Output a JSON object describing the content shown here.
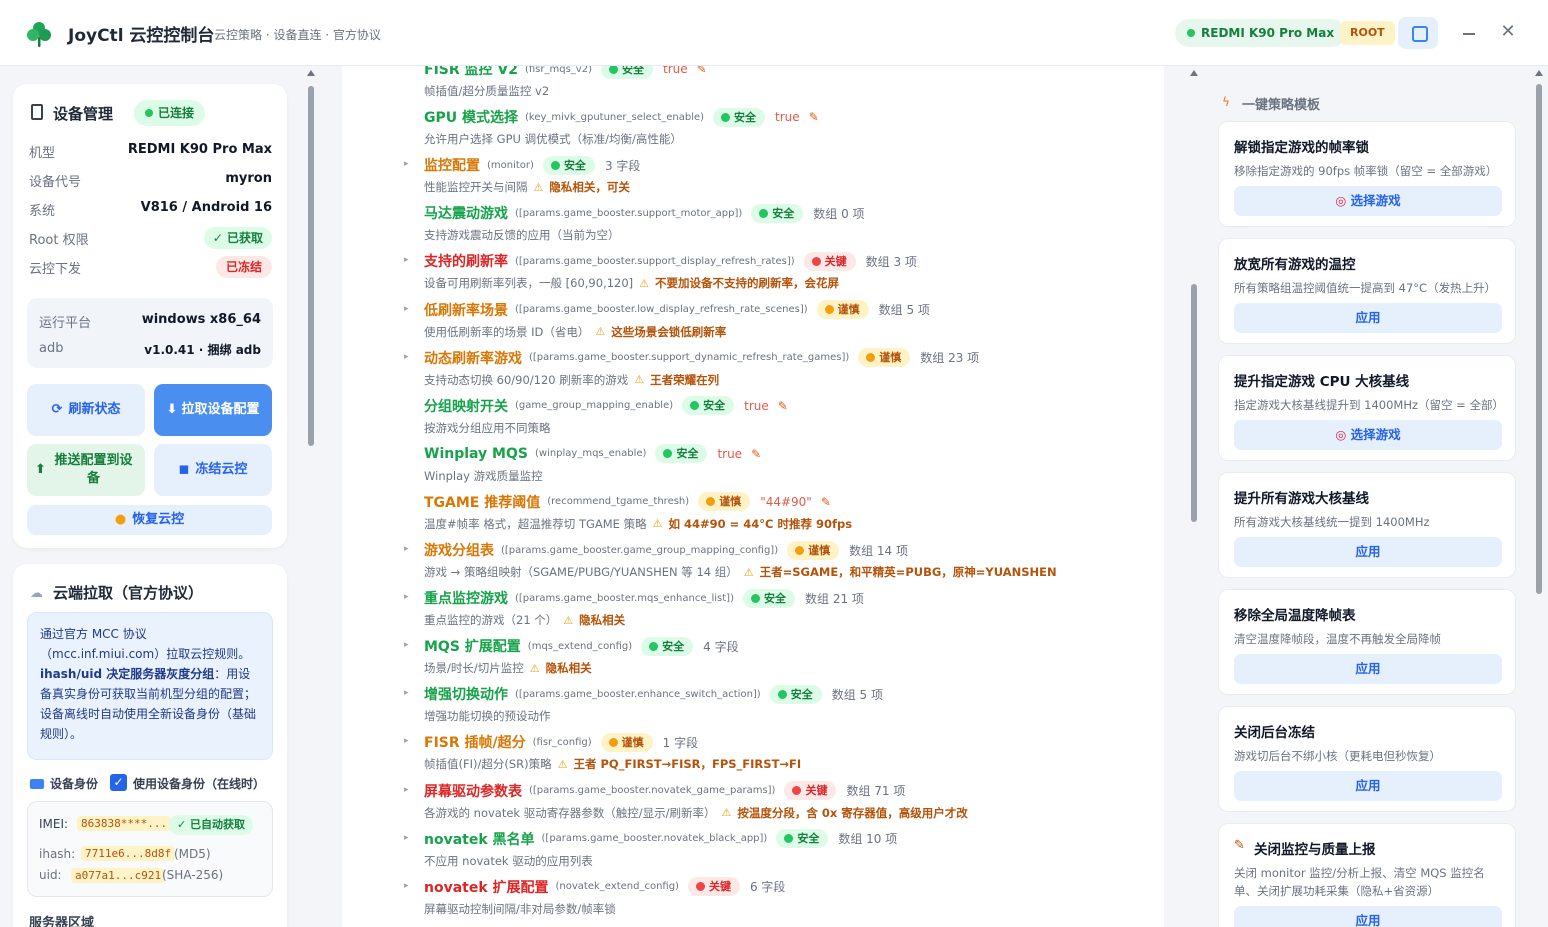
{
  "app": {
    "title": "JoyCtl 云控控制台",
    "subtitle": "云控策略 · 设备直连 · 官方协议",
    "device_pill": "REDMI K90 Pro Max",
    "root_pill": "ROOT"
  },
  "device": {
    "title": "设备管理",
    "status": "已连接",
    "rows": [
      {
        "k": "机型",
        "v": "REDMI K90 Pro Max"
      },
      {
        "k": "设备代号",
        "v": "myron"
      },
      {
        "k": "系统",
        "v": "V816 / Android 16"
      },
      {
        "k": "Root 权限",
        "v": "✓ 已获取"
      },
      {
        "k": "云控下发",
        "v": "已冻结"
      }
    ],
    "platform_k": "运行平台",
    "platform_v": "windows x86_64",
    "adb_k": "adb",
    "adb_v": "v1.0.41 · 捆绑 adb",
    "btn_refresh": "刷新状态",
    "btn_pull": "拉取设备配置",
    "btn_push": "推送配置到设备",
    "btn_freeze": "冻结云控",
    "btn_restore": "恢复云控"
  },
  "cloud": {
    "title": "云端拉取（官方协议）",
    "info_1": "通过官方 MCC 协议（mcc.inf.miui.com）拉取云控规则。",
    "info_bold": "ihash/uid 决定服务器灰度分组",
    "info_2": "：用设备真实身份可获取当前机型分组的配置；设备离线时自动使用全新设备身份（基础规则）。",
    "identity_label": "设备身份",
    "identity_check": "使用设备身份（在线时）",
    "imei_k": "IMEI:",
    "imei_v": "863838****...",
    "imei_tag": "✓ 已自动获取",
    "ihash_k": "ihash:",
    "ihash_v": "7711e6...8d8f",
    "ihash_t": "(MD5)",
    "uid_k": "uid:",
    "uid_v": "a077a1...c921",
    "uid_t": "(SHA-256)",
    "server_label": "服务器区域"
  },
  "rows": [
    {
      "name": "FISR 监控 V2",
      "key": "(fisr_mqs_v2)",
      "badge": "安全",
      "btype": "safe",
      "val": "true",
      "valtype": "red",
      "pen": true,
      "caret": false,
      "color": "green",
      "desc": "帧插值/超分质量监控 v2",
      "warn": ""
    },
    {
      "name": "GPU 模式选择",
      "key": "(key_mivk_gputuner_select_enable)",
      "badge": "安全",
      "btype": "safe",
      "val": "true",
      "valtype": "red",
      "pen": true,
      "caret": false,
      "color": "green",
      "desc": "允许用户选择 GPU 调优模式（标准/均衡/高性能）",
      "warn": ""
    },
    {
      "name": "监控配置",
      "key": "(monitor)",
      "badge": "安全",
      "btype": "safe",
      "val": "3 字段",
      "valtype": "gray",
      "pen": false,
      "caret": true,
      "color": "amber",
      "desc": "性能监控开关与间隔",
      "warn": "隐私相关，可关"
    },
    {
      "name": "马达震动游戏",
      "key": "([params.game_booster.support_motor_app])",
      "badge": "安全",
      "btype": "safe",
      "val": "数组 0 项",
      "valtype": "gray",
      "pen": false,
      "caret": false,
      "color": "green",
      "desc": "支持游戏震动反馈的应用（当前为空）",
      "warn": ""
    },
    {
      "name": "支持的刷新率",
      "key": "([params.game_booster.support_display_refresh_rates])",
      "badge": "关键",
      "btype": "key",
      "val": "数组 3 项",
      "valtype": "gray",
      "pen": false,
      "caret": true,
      "color": "red",
      "desc": "设备可用刷新率列表，一般 [60,90,120]",
      "warn": "不要加设备不支持的刷新率，会花屏"
    },
    {
      "name": "低刷新率场景",
      "key": "([params.game_booster.low_display_refresh_rate_scenes])",
      "badge": "谨慎",
      "btype": "care",
      "val": "数组 5 项",
      "valtype": "gray",
      "pen": false,
      "caret": true,
      "color": "amber",
      "desc": "使用低刷新率的场景 ID（省电）",
      "warn": "这些场景会锁低刷新率"
    },
    {
      "name": "动态刷新率游戏",
      "key": "([params.game_booster.support_dynamic_refresh_rate_games])",
      "badge": "谨慎",
      "btype": "care",
      "val": "数组 23 项",
      "valtype": "gray",
      "pen": false,
      "caret": true,
      "color": "amber",
      "desc": "支持动态切换 60/90/120 刷新率的游戏",
      "warn": "王者荣耀在列"
    },
    {
      "name": "分组映射开关",
      "key": "(game_group_mapping_enable)",
      "badge": "安全",
      "btype": "safe",
      "val": "true",
      "valtype": "red",
      "pen": true,
      "caret": false,
      "color": "green",
      "desc": "按游戏分组应用不同策略",
      "warn": ""
    },
    {
      "name": "Winplay MQS",
      "key": "(winplay_mqs_enable)",
      "badge": "安全",
      "btype": "safe",
      "val": "true",
      "valtype": "red",
      "pen": true,
      "caret": false,
      "color": "green",
      "desc": "Winplay 游戏质量监控",
      "warn": ""
    },
    {
      "name": "TGAME 推荐阈值",
      "key": "(recommend_tgame_thresh)",
      "badge": "谨慎",
      "btype": "care",
      "val": "\"44#90\"",
      "valtype": "red",
      "pen": true,
      "caret": false,
      "color": "amber",
      "desc": "温度#帧率 格式，超温推荐切 TGAME 策略",
      "warn": "如 44#90 = 44°C 时推荐 90fps"
    },
    {
      "name": "游戏分组表",
      "key": "([params.game_booster.game_group_mapping_config])",
      "badge": "谨慎",
      "btype": "care",
      "val": "数组 14 项",
      "valtype": "gray",
      "pen": false,
      "caret": true,
      "color": "amber",
      "desc": "游戏 → 策略组映射（SGAME/PUBG/YUANSHEN 等 14 组）",
      "warn": "王者=SGAME，和平精英=PUBG，原神=YUANSHEN"
    },
    {
      "name": "重点监控游戏",
      "key": "([params.game_booster.mqs_enhance_list])",
      "badge": "安全",
      "btype": "safe",
      "val": "数组 21 项",
      "valtype": "gray",
      "pen": false,
      "caret": true,
      "color": "green",
      "desc": "重点监控的游戏（21 个）",
      "warn": "隐私相关"
    },
    {
      "name": "MQS 扩展配置",
      "key": "(mqs_extend_config)",
      "badge": "安全",
      "btype": "safe",
      "val": "4 字段",
      "valtype": "gray",
      "pen": false,
      "caret": true,
      "color": "green",
      "desc": "场景/时长/切片监控",
      "warn": "隐私相关"
    },
    {
      "name": "增强切换动作",
      "key": "([params.game_booster.enhance_switch_action])",
      "badge": "安全",
      "btype": "safe",
      "val": "数组 5 项",
      "valtype": "gray",
      "pen": false,
      "caret": true,
      "color": "green",
      "desc": "增强功能切换的预设动作",
      "warn": ""
    },
    {
      "name": "FISR 插帧/超分",
      "key": "(fisr_config)",
      "badge": "谨慎",
      "btype": "care",
      "val": "1 字段",
      "valtype": "gray",
      "pen": false,
      "caret": true,
      "color": "amber",
      "desc": "帧插值(FI)/超分(SR)策略",
      "warn": "王者 PQ_FIRST→FISR，FPS_FIRST→FI"
    },
    {
      "name": "屏幕驱动参数表",
      "key": "([params.game_booster.novatek_game_params])",
      "badge": "关键",
      "btype": "key",
      "val": "数组 71 项",
      "valtype": "gray",
      "pen": false,
      "caret": true,
      "color": "red",
      "desc": "各游戏的 novatek 驱动寄存器参数（触控/显示/刷新率）",
      "warn": "按温度分段，含 0x 寄存器值，高级用户才改"
    },
    {
      "name": "novatek 黑名单",
      "key": "([params.game_booster.novatek_black_app])",
      "badge": "安全",
      "btype": "safe",
      "val": "数组 10 项",
      "valtype": "gray",
      "pen": false,
      "caret": true,
      "color": "green",
      "desc": "不应用 novatek 驱动的应用列表",
      "warn": ""
    },
    {
      "name": "novatek 扩展配置",
      "key": "(novatek_extend_config)",
      "badge": "关键",
      "btype": "key",
      "val": "6 字段",
      "valtype": "gray",
      "pen": false,
      "caret": true,
      "color": "red",
      "desc": "屏幕驱动控制间隔/非对局参数/帧率锁",
      "warn": ""
    }
  ],
  "templates": {
    "title": "一键策略模板",
    "cards": [
      {
        "title": "解锁指定游戏的帧率锁",
        "desc": "移除指定游戏的 90fps 帧率锁（留空 = 全部游戏）",
        "btn": "选择游戏",
        "target": true
      },
      {
        "title": "放宽所有游戏的温控",
        "desc": "所有策略组温控阈值统一提高到 47°C（发热上升）",
        "btn": "应用",
        "target": false
      },
      {
        "title": "提升指定游戏 CPU 大核基线",
        "desc": "指定游戏大核基线提升到 1400MHz（留空 = 全部）",
        "btn": "选择游戏",
        "target": true
      },
      {
        "title": "提升所有游戏大核基线",
        "desc": "所有游戏大核基线统一提到 1400MHz",
        "btn": "应用",
        "target": false
      },
      {
        "title": "移除全局温度降帧表",
        "desc": "清空温度降帧段，温度不再触发全局降帧",
        "btn": "应用",
        "target": false
      },
      {
        "title": "关闭后台冻结",
        "desc": "游戏切后台不绑小核（更耗电但秒恢复）",
        "btn": "应用",
        "target": false
      },
      {
        "title": "关闭监控与质量上报",
        "desc": "关闭 monitor 监控/分析上报、清空 MQS 监控名单、关闭扩展功耗采集（隐私+省资源）",
        "btn": "应用",
        "target": false
      }
    ]
  },
  "colors": {
    "safe": "#22c55e",
    "careful": "#f59e0b",
    "critical": "#ef4444",
    "accent": "#3b82f6"
  }
}
